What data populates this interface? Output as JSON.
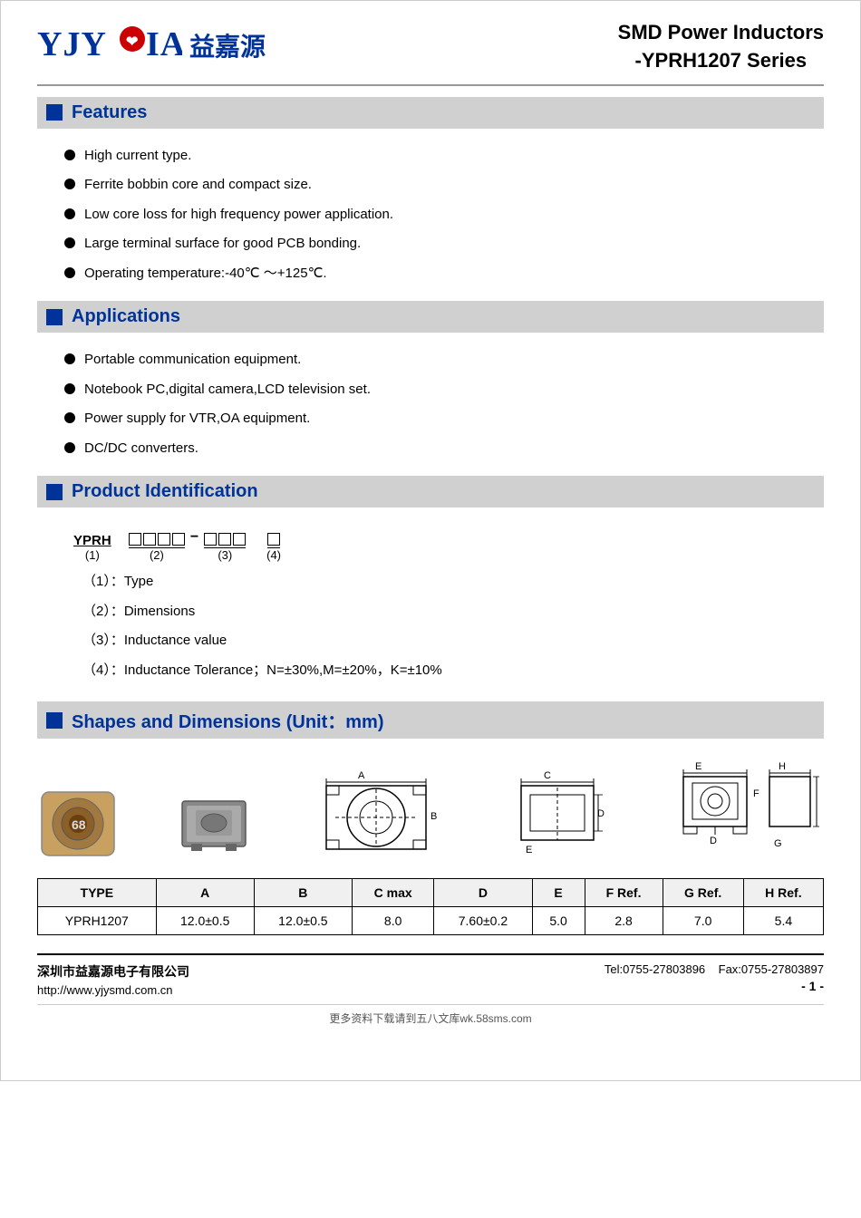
{
  "header": {
    "logo_text": "YJYC●IA",
    "logo_cn": "益嘉源",
    "title_line1": "SMD Power Inductors",
    "title_line2": "-YPRH1207 Series"
  },
  "sections": {
    "features": {
      "title": "Features",
      "items": [
        "High current type.",
        "Ferrite bobbin core and compact size.",
        "Low core loss for high frequency power application.",
        "Large terminal surface for good PCB bonding.",
        "Operating temperature:-40℃ ～+125℃."
      ]
    },
    "applications": {
      "title": "Applications",
      "items": [
        "Portable communication equipment.",
        "Notebook PC,digital camera,LCD television set.",
        "Power supply for VTR,OA equipment.",
        "DC/DC converters."
      ]
    },
    "product_id": {
      "title": "Product Identification",
      "code_parts": {
        "yprh": "YPRH",
        "part1_label": "(1)",
        "part2_label": "(2)",
        "part3_label": "(3)",
        "part4_label": "(4)"
      },
      "descriptions": [
        "（1）：Type",
        "（2）：Dimensions",
        "（3）：Inductance value",
        "（4）：Inductance Tolerance；N=±30%,M=±20%，K=±10%"
      ]
    },
    "shapes": {
      "title": "Shapes and Dimensions (Unit：mm)",
      "dimension_labels": {
        "A": "A",
        "B": "B",
        "C": "C",
        "E": "E",
        "H": "H",
        "F": "F",
        "G": "G",
        "D": "D"
      }
    }
  },
  "table": {
    "headers": [
      "TYPE",
      "A",
      "B",
      "C max",
      "D",
      "E",
      "F Ref.",
      "G Ref.",
      "H Ref."
    ],
    "rows": [
      [
        "YPRH1207",
        "12.0±0.5",
        "12.0±0.5",
        "8.0",
        "7.60±0.2",
        "5.0",
        "2.8",
        "7.0",
        "5.4"
      ]
    ]
  },
  "footer": {
    "company": "深圳市益嘉源电子有限公司",
    "website": "http://www.yjysmd.com.cn",
    "tel": "Tel:0755-27803896",
    "fax": "Fax:0755-27803897",
    "page": "- 1 -"
  },
  "bottom_note": "更多资料下载请到五八文库wk.58sms.com"
}
